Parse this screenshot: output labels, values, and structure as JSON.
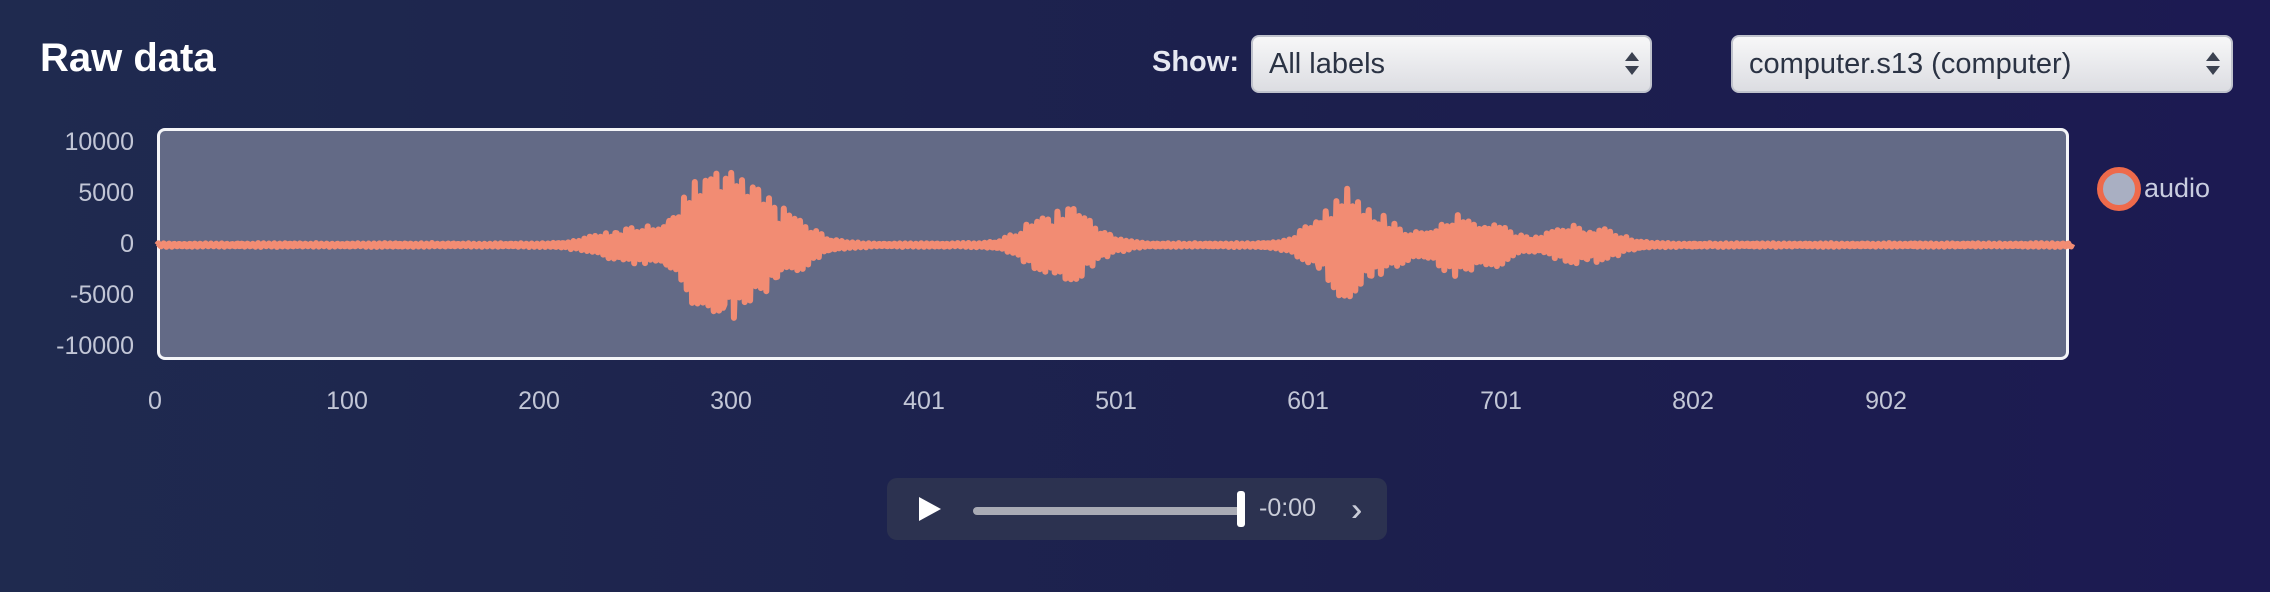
{
  "header": {
    "title": "Raw data",
    "show_label": "Show:",
    "label_filter": {
      "selected": "All labels"
    },
    "sample_select": {
      "selected": "computer.s13 (computer)"
    }
  },
  "chart_data": {
    "type": "line",
    "y_ticks": [
      "10000",
      "5000",
      "0",
      "-5000",
      "-10000"
    ],
    "x_ticks": [
      "0",
      "100",
      "200",
      "300",
      "401",
      "501",
      "601",
      "701",
      "802",
      "902"
    ],
    "ylim": [
      -10000,
      10000
    ],
    "xlim": [
      0,
      995
    ],
    "series": [
      {
        "name": "audio",
        "color": "#f28c73",
        "bursts": [
          {
            "x": 245,
            "amp": 1600
          },
          {
            "x": 290,
            "amp": 7500
          },
          {
            "x": 320,
            "amp": 3500
          },
          {
            "x": 470,
            "amp": 3500
          },
          {
            "x": 620,
            "amp": 5000
          },
          {
            "x": 680,
            "amp": 3000
          },
          {
            "x": 740,
            "amp": 1800
          }
        ]
      }
    ],
    "legend": {
      "position": "right"
    }
  },
  "player": {
    "time": "-0:00",
    "progress": 1.0
  },
  "colors": {
    "plot_bg": "#636a86",
    "wave": "#f28c73",
    "legend_ring": "#ee6a4b"
  }
}
